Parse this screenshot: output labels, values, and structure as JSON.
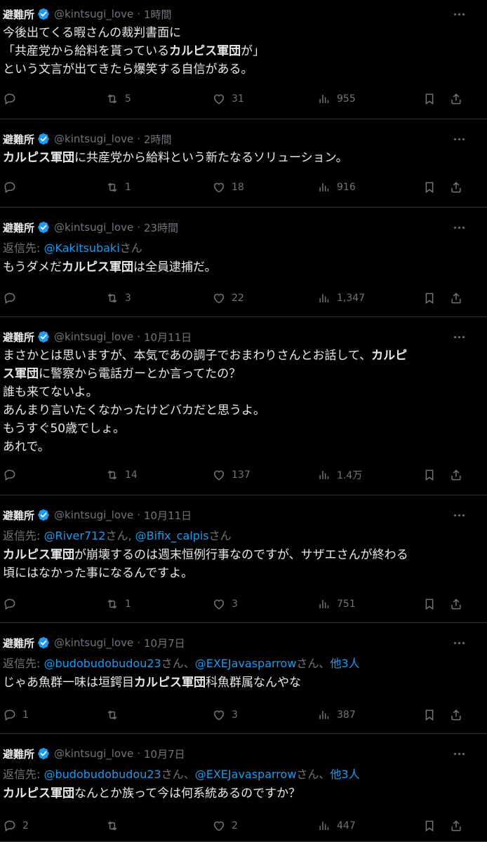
{
  "tweets": [
    {
      "name": "避難所",
      "handle": "@kintsugi_love",
      "time": "1時間",
      "reply_to": null,
      "lines": [
        [
          {
            "t": "今後出てくる暇さんの裁判書面に"
          }
        ],
        [
          {
            "t": "「共産党から給料を貰っている"
          },
          {
            "t": "カルピス軍団",
            "b": true
          },
          {
            "t": "が」"
          }
        ],
        [
          {
            "t": "という文言が出てきたら爆笑する自信がある。"
          }
        ]
      ],
      "replies": "",
      "retweets": "5",
      "likes": "31",
      "views": "955"
    },
    {
      "name": "避難所",
      "handle": "@kintsugi_love",
      "time": "2時間",
      "reply_to": null,
      "lines": [
        [
          {
            "t": "カルピス軍団",
            "b": true
          },
          {
            "t": "に共産党から給料という新たなるソリューション。"
          }
        ]
      ],
      "replies": "",
      "retweets": "1",
      "likes": "18",
      "views": "916"
    },
    {
      "name": "避難所",
      "handle": "@kintsugi_love",
      "time": "23時間",
      "reply_to": [
        {
          "t": "返信先: "
        },
        {
          "t": "@Kakitsubaki",
          "m": true
        },
        {
          "t": "さん"
        }
      ],
      "lines": [
        [
          {
            "t": "もうダメだ"
          },
          {
            "t": "カルピス軍団",
            "b": true
          },
          {
            "t": "は全員逮捕だ。"
          }
        ]
      ],
      "replies": "",
      "retweets": "3",
      "likes": "22",
      "views": "1,347"
    },
    {
      "name": "避難所",
      "handle": "@kintsugi_love",
      "time": "10月11日",
      "reply_to": null,
      "lines": [
        [
          {
            "t": "まさかとは思いますが、本気であの調子でおまわりさんとお話して、"
          },
          {
            "t": "カルピ",
            "b": true
          }
        ],
        [
          {
            "t": "ス軍団",
            "b": true
          },
          {
            "t": "に警察から電話ガーとか言ってたの？"
          }
        ],
        [
          {
            "t": "誰も来てないよ。"
          }
        ],
        [
          {
            "t": "あんまり言いたくなかったけどバカだと思うよ。"
          }
        ],
        [
          {
            "t": "もうすぐ50歳でしょ。"
          }
        ],
        [
          {
            "t": "あれで。"
          }
        ]
      ],
      "replies": "",
      "retweets": "14",
      "likes": "137",
      "views": "1.4万"
    },
    {
      "name": "避難所",
      "handle": "@kintsugi_love",
      "time": "10月11日",
      "reply_to": [
        {
          "t": "返信先: "
        },
        {
          "t": "@River712",
          "m": true
        },
        {
          "t": "さん, "
        },
        {
          "t": "@Bifix_calpis",
          "m": true
        },
        {
          "t": "さん"
        }
      ],
      "lines": [
        [
          {
            "t": "カルピス軍団",
            "b": true
          },
          {
            "t": "が崩壊するのは週末恒例行事なのですが、サザエさんが終わる"
          }
        ],
        [
          {
            "t": "頃にはなかった事になるんですよ。"
          }
        ]
      ],
      "replies": "",
      "retweets": "1",
      "likes": "3",
      "views": "751"
    },
    {
      "name": "避難所",
      "handle": "@kintsugi_love",
      "time": "10月7日",
      "reply_to": [
        {
          "t": "返信先: "
        },
        {
          "t": "@budobudobudou23",
          "m": true
        },
        {
          "t": "さん、"
        },
        {
          "t": "@EXEJavasparrow",
          "m": true
        },
        {
          "t": "さん、"
        },
        {
          "t": "他3人",
          "m": true
        }
      ],
      "lines": [
        [
          {
            "t": "じゃあ魚群一味は垣鍔目"
          },
          {
            "t": "カルピス軍団",
            "b": true
          },
          {
            "t": "科魚群属なんやな"
          }
        ]
      ],
      "replies": "1",
      "retweets": "",
      "likes": "3",
      "views": "387"
    },
    {
      "name": "避難所",
      "handle": "@kintsugi_love",
      "time": "10月7日",
      "reply_to": [
        {
          "t": "返信先: "
        },
        {
          "t": "@budobudobudou23",
          "m": true
        },
        {
          "t": "さん、"
        },
        {
          "t": "@EXEJavasparrow",
          "m": true
        },
        {
          "t": "さん、"
        },
        {
          "t": "他3人",
          "m": true
        }
      ],
      "lines": [
        [
          {
            "t": "カルピス軍団",
            "b": true
          },
          {
            "t": "なんとか族って今は何系統あるのですか？"
          }
        ]
      ],
      "replies": "2",
      "retweets": "",
      "likes": "2",
      "views": "447"
    }
  ],
  "icons": [
    "verified-badge-icon",
    "more-icon",
    "reply-icon",
    "retweet-icon",
    "like-icon",
    "views-icon",
    "bookmark-icon",
    "share-icon"
  ],
  "colors": {
    "background": "#000000",
    "text": "#e7e9ea",
    "muted": "#71767b",
    "link": "#1d9bf0",
    "badge": "#1d9bf0",
    "divider": "#2f3336"
  }
}
